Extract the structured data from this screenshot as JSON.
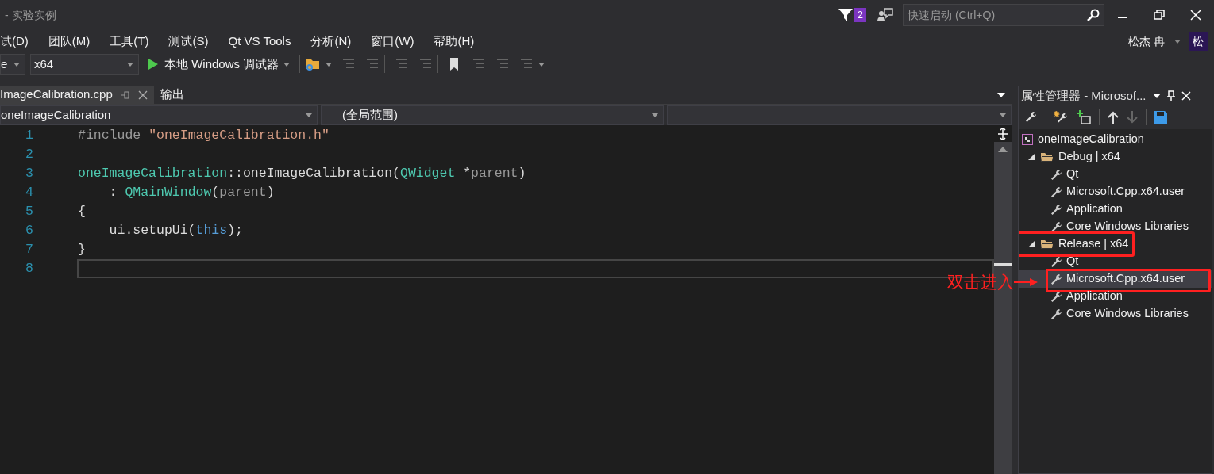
{
  "window": {
    "title": "- 实验实例",
    "notification_count": "2",
    "quick_launch": {
      "placeholder": "快速启动 (Ctrl+Q)"
    },
    "user": {
      "name": "松杰 冉",
      "initial": "松"
    }
  },
  "menu": [
    "试(D)",
    "团队(M)",
    "工具(T)",
    "测试(S)",
    "Qt VS Tools",
    "分析(N)",
    "窗口(W)",
    "帮助(H)"
  ],
  "toolbar": {
    "config": "e",
    "platform": "x64",
    "debugger": "本地 Windows 调试器"
  },
  "tabs": [
    {
      "label": "ImageCalibration.cpp",
      "selected": true
    },
    {
      "label": "输出",
      "selected": false
    }
  ],
  "navigation": {
    "project": "oneImageCalibration",
    "scope": "(全局范围)"
  },
  "editor": {
    "lines": [
      {
        "number": "1",
        "current": false,
        "tokens": [
          {
            "kind": "preproc",
            "text": "#include "
          },
          {
            "kind": "string",
            "text": "\"oneImageCalibration.h\""
          }
        ]
      },
      {
        "number": "2",
        "current": false
      },
      {
        "number": "3",
        "current": false,
        "fold": true,
        "tokens": [
          {
            "kind": "type",
            "text": "oneImageCalibration"
          },
          {
            "kind": "plain",
            "text": "::oneImageCalibration("
          },
          {
            "kind": "type",
            "text": "QWidget"
          },
          {
            "kind": "plain",
            "text": " *"
          },
          {
            "kind": "param",
            "text": "parent"
          },
          {
            "kind": "plain",
            "text": ")"
          }
        ]
      },
      {
        "number": "4",
        "current": false,
        "tokens": [
          {
            "kind": "plain",
            "text": "    : "
          },
          {
            "kind": "type",
            "text": "QMainWindow"
          },
          {
            "kind": "plain",
            "text": "("
          },
          {
            "kind": "param",
            "text": "parent"
          },
          {
            "kind": "plain",
            "text": ")"
          }
        ]
      },
      {
        "number": "5",
        "current": false,
        "tokens": [
          {
            "kind": "plain",
            "text": "{"
          }
        ]
      },
      {
        "number": "6",
        "current": false,
        "tokens": [
          {
            "kind": "plain",
            "text": "    ui.setupUi("
          },
          {
            "kind": "keyword",
            "text": "this"
          },
          {
            "kind": "plain",
            "text": ");"
          }
        ]
      },
      {
        "number": "7",
        "current": false,
        "tokens": [
          {
            "kind": "plain",
            "text": "}"
          }
        ]
      },
      {
        "number": "8",
        "current": true
      }
    ]
  },
  "property_manager": {
    "title": "属性管理器 - Microsof...",
    "tree": [
      {
        "label": "oneImageCalibration",
        "kind": "project",
        "selected": false,
        "boxed": false,
        "children": [
          {
            "label": "Debug | x64",
            "kind": "config",
            "expanded": true,
            "selected": false,
            "boxed": false,
            "children": [
              {
                "label": "Qt",
                "kind": "sheet",
                "selected": false,
                "boxed": false
              },
              {
                "label": "Microsoft.Cpp.x64.user",
                "kind": "sheet",
                "selected": false,
                "boxed": false
              },
              {
                "label": "Application",
                "kind": "sheet",
                "selected": false,
                "boxed": false
              },
              {
                "label": "Core Windows Libraries",
                "kind": "sheet",
                "selected": false,
                "boxed": false
              }
            ]
          },
          {
            "label": "Release | x64",
            "kind": "config",
            "expanded": true,
            "selected": false,
            "boxed": true,
            "children": [
              {
                "label": "Qt",
                "kind": "sheet",
                "selected": false,
                "boxed": false
              },
              {
                "label": "Microsoft.Cpp.x64.user",
                "kind": "sheet",
                "selected": true,
                "boxed": true
              },
              {
                "label": "Application",
                "kind": "sheet",
                "selected": false,
                "boxed": false
              },
              {
                "label": "Core Windows Libraries",
                "kind": "sheet",
                "selected": false,
                "boxed": false
              }
            ]
          }
        ]
      }
    ]
  },
  "annotation": {
    "text": "双击进入"
  }
}
